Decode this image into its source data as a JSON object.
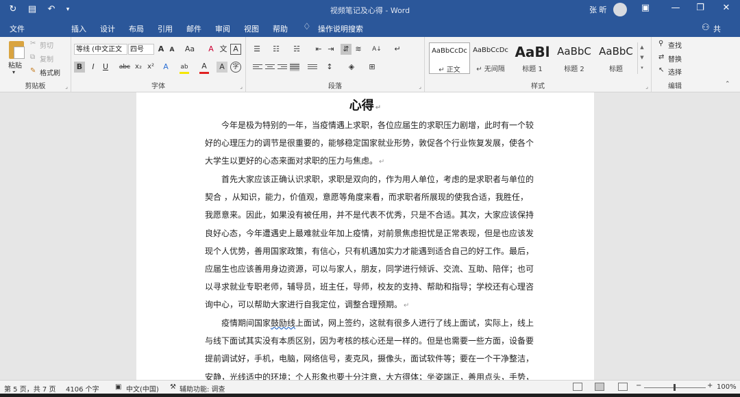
{
  "window": {
    "title": "视频笔记及心得 - Word",
    "user_name": "张 昕",
    "qat_icons": [
      "autosave-icon",
      "save-icon",
      "undo-icon",
      "customize-icon"
    ],
    "ribbon_display_icon": "ribbon-display-icon",
    "controls": [
      "minimize-icon",
      "restore-icon",
      "close-icon"
    ]
  },
  "tabs": [
    {
      "label": "文件"
    },
    {
      "label": "插入"
    },
    {
      "label": "设计"
    },
    {
      "label": "布局"
    },
    {
      "label": "引用"
    },
    {
      "label": "邮件"
    },
    {
      "label": "审阅"
    },
    {
      "label": "视图"
    },
    {
      "label": "帮助"
    }
  ],
  "tell_me": "操作说明搜索",
  "share_label": "共",
  "ribbon": {
    "clipboard": {
      "label": "剪贴板",
      "paste": "粘贴",
      "cut": "剪切",
      "copy": "复制",
      "format_painter": "格式刷"
    },
    "font": {
      "label": "字体",
      "font_name": "等线 (中文正文",
      "font_size": "四号",
      "grow": "A",
      "shrink": "A",
      "case": "Aa",
      "clear": "A",
      "phonetic": "文",
      "border": "A",
      "bold": "B",
      "italic": "I",
      "underline": "U",
      "strike": "abc",
      "subscript": "x₂",
      "superscript": "x²",
      "effects": "A",
      "highlight": "ab",
      "font_color": "A",
      "shading": "A",
      "enclose": "字",
      "highlight_color": "#f5e600",
      "font_color_value": "#e02020"
    },
    "paragraph": {
      "label": "段落",
      "sort": "A↓",
      "show_marks": "↵"
    },
    "styles": {
      "label": "样式",
      "items": [
        {
          "sample": "AaBbCcDc",
          "name": "↵ 正文"
        },
        {
          "sample": "AaBbCcDc",
          "name": "↵ 无间隔"
        },
        {
          "sample": "AaBl",
          "name": "标题 1"
        },
        {
          "sample": "AaBbC",
          "name": "标题 2"
        },
        {
          "sample": "AaBbC",
          "name": "标题"
        }
      ]
    },
    "editing": {
      "label": "编辑",
      "find": "查找",
      "replace": "替换",
      "select": "选择"
    }
  },
  "document": {
    "heading": "心得",
    "paragraphs": [
      {
        "lines": [
          "今年是极为特别的一年，当疫情遇上求职，各位应届生的求职压力剧增，此时有一个较",
          "好的心理压力的调节是很重要的，能够稳定国家就业形势，敦促各个行业恢复发展，使各个",
          "大学生以更好的心态来面对求职的压力与焦虑。"
        ]
      },
      {
        "lines": [
          "首先大家应该正确认识求职，求职是双向的，作为用人单位，考虑的是求职者与单位的",
          "契合 ，从知识，能力，价值观，意愿等角度来看，而求职者所展现的使我合适，我胜任，",
          "我愿意来。因此，如果没有被任用，并不是代表不优秀，只是不合适。其次，大家应该保持",
          "良好心态，今年遭遇史上最难就业年加上疫情，对前景焦虑担忧是正常表现，但是也应该发",
          "现个人优势，善用国家政策，有信心，只有机遇加实力才能遇到适合自己的好工作。最后，",
          "应届生也应该善用身边资源，可以与家人，朋友，同学进行倾诉、交流、互助、陪伴；也可",
          "以寻求就业专职老师，辅导员，班主任，导师，校友的支持、帮助和指导；学校还有心理咨",
          "询中心，可以帮助大家进行自我定位，调整合理预期。"
        ]
      },
      {
        "lines": [
          "疫情期间国家鼓励线上面试，网上签约，这就有很多人进行了线上面试，实际上，线上",
          "与线下面试其实没有本质区别，因为考核的核心还是一样的。但是也需要一些方面，设备要",
          "提前调试好，手机，电脑，网络信号，麦克风，摄像头，面试软件等；要在一个干净整洁，",
          "安静，光线适中的环境；个人形象也要十分注意，大方得体；坐姿端正，善用点头，手势，"
        ]
      }
    ],
    "squiggle_word": "鼓励线"
  },
  "status": {
    "page": "第 5 页，共 7 页",
    "words": "4106 个字",
    "language": "中文(中国)",
    "accessibility": "辅助功能: 调查",
    "zoom": "100%",
    "zoom_value": 100
  }
}
